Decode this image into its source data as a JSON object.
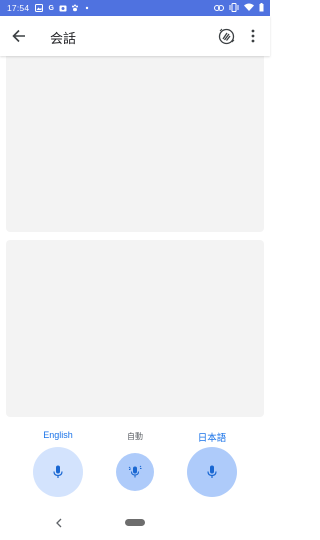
{
  "status_bar": {
    "time": "17:54",
    "left_icons": [
      "image-icon",
      "google-icon",
      "photo-icon",
      "paw-icon",
      "dot-icon"
    ],
    "right_icons": [
      "link-icon",
      "vibrate-icon",
      "wifi-icon",
      "battery-icon"
    ],
    "background": "#4f72e0"
  },
  "app_bar": {
    "title": "会話"
  },
  "languages": {
    "left": "English",
    "middle": "自動",
    "right": "日本語"
  },
  "colors": {
    "accent": "#1a73e8",
    "mic_light": "#d3e3fd",
    "mic_active": "#aecbfa",
    "panel": "#f3f3f3"
  }
}
